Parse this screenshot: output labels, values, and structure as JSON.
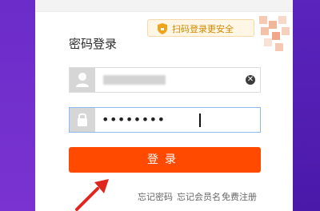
{
  "login_panel": {
    "qr_tip": "扫码登录更安全",
    "title": "密码登录",
    "password_mask": "••••••••",
    "login_button": "登录",
    "links": {
      "forgot_password": "忘记密码",
      "forgot_member": "忘记会员名",
      "register": "免费注册"
    }
  },
  "icons": {
    "shield": "shield-icon",
    "user": "user-icon",
    "lock": "lock-icon",
    "clear": "clear-icon",
    "arrow": "red-arrow-annotation"
  },
  "colors": {
    "login_button": "#ff4a00",
    "qr_tip_text": "#d38900",
    "background_purple": "#5a22b8"
  }
}
